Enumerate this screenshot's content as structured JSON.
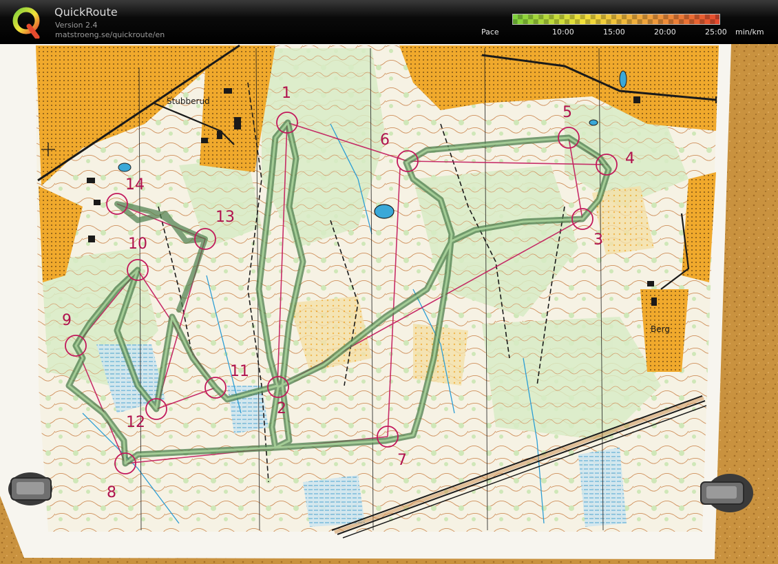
{
  "app": {
    "name": "QuickRoute",
    "version": "Version 2.4",
    "url": "matstroeng.se/quickroute/en"
  },
  "pace_scale": {
    "label": "Pace",
    "ticks": [
      "10:00",
      "15:00",
      "20:00",
      "25:00"
    ],
    "unit": "min/km"
  },
  "map": {
    "place_labels": [
      "Stubberud",
      "Berg"
    ],
    "controls": [
      {
        "number": "1"
      },
      {
        "number": "2"
      },
      {
        "number": "3"
      },
      {
        "number": "4"
      },
      {
        "number": "5"
      },
      {
        "number": "6"
      },
      {
        "number": "7"
      },
      {
        "number": "8"
      },
      {
        "number": "9"
      },
      {
        "number": "10"
      },
      {
        "number": "11"
      },
      {
        "number": "12"
      },
      {
        "number": "13"
      },
      {
        "number": "14"
      }
    ]
  }
}
